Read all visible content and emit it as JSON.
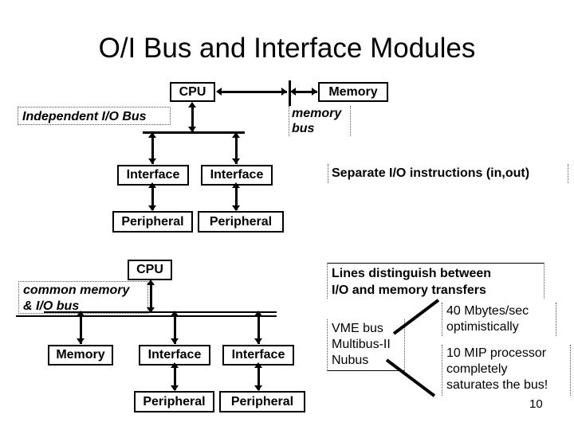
{
  "slide": {
    "title": "O/I Bus and Interface Modules",
    "page_number": "10",
    "background_color": "#ffffff",
    "ink_color": "#000000"
  },
  "diagram_top": {
    "name": "independent-io-bus-diagram",
    "label": "Independent I/O Bus",
    "memory_bus_label": "memory\nbus",
    "nodes": {
      "cpu": "CPU",
      "memory": "Memory",
      "interface_1": "Interface",
      "interface_2": "Interface",
      "peripheral_1": "Peripheral",
      "peripheral_2": "Peripheral"
    },
    "annotation": "Separate I/O instructions (in,out)"
  },
  "diagram_bottom": {
    "name": "common-memory-io-bus-diagram",
    "label": "common memory\n& I/O bus",
    "nodes": {
      "cpu": "CPU",
      "memory": "Memory",
      "interface_1": "Interface",
      "interface_2": "Interface",
      "peripheral_1": "Peripheral",
      "peripheral_2": "Peripheral"
    }
  },
  "notes": {
    "lines_distinguish": "Lines distinguish between\n    I/O and memory transfers",
    "bus_names": "VME bus\nMultibus-II\nNubus",
    "bandwidth": "40 Mbytes/sec\noptimistically",
    "saturation": "10 MIP processor\ncompletely\nsaturates the bus!"
  }
}
